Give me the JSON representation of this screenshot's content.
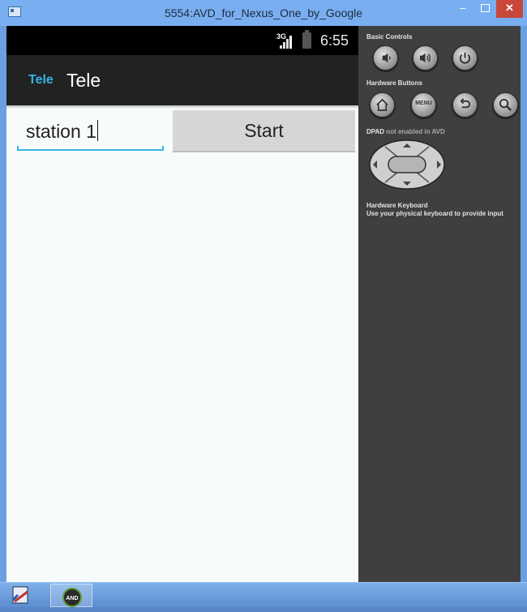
{
  "window": {
    "title": "5554:AVD_for_Nexus_One_by_Google",
    "minimize_label": "–",
    "close_label": "✕"
  },
  "statusbar": {
    "network": "3G",
    "time": "6:55"
  },
  "app": {
    "icon_text": "Tele",
    "title": "Tele"
  },
  "form": {
    "station_value": "station 1",
    "start_label": "Start"
  },
  "controls": {
    "basic_label": "Basic Controls",
    "hardware_label": "Hardware Buttons",
    "menu_label": "MENU",
    "dpad_label": "DPAD",
    "dpad_note": " not enabled in AVD",
    "keyboard_label": "Hardware Keyboard",
    "keyboard_note": "Use your physical keyboard to provide input"
  },
  "taskbar": {
    "items": [
      {
        "icon": "sdk-tool-icon"
      },
      {
        "icon": "android-emulator-icon",
        "label": "AND"
      }
    ]
  },
  "colors": {
    "accent": "#33b5e5",
    "window_frame": "#79aef0",
    "close_button": "#c9473b"
  }
}
